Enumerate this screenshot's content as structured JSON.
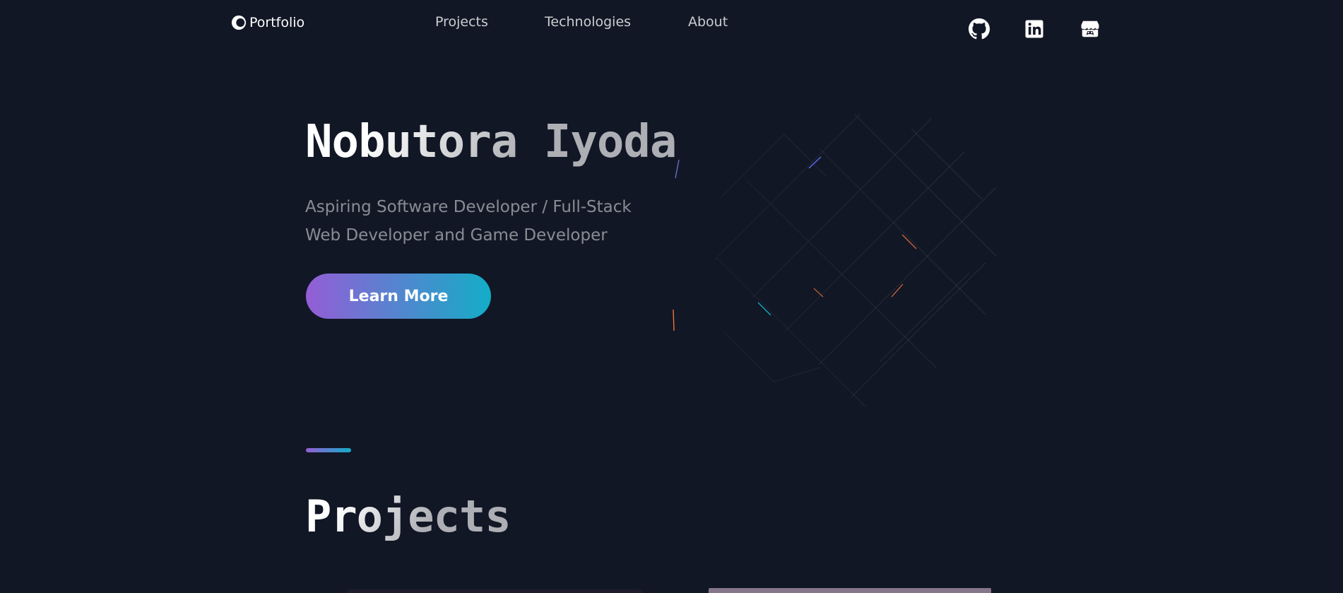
{
  "header": {
    "logo": {
      "text": "Portfolio",
      "icon": "portfolio-logo-icon"
    },
    "nav": [
      {
        "label": "Projects"
      },
      {
        "label": "Technologies"
      },
      {
        "label": "About"
      }
    ],
    "socials": [
      {
        "icon": "github-icon"
      },
      {
        "icon": "linkedin-icon"
      },
      {
        "icon": "itch-io-icon"
      }
    ]
  },
  "hero": {
    "title": "Nobutora Iyoda",
    "subtitle": "Aspiring Software Developer / Full-Stack Web Developer and Game Developer",
    "cta_label": "Learn More"
  },
  "projects": {
    "title": "Projects"
  },
  "colors": {
    "background": "#111725",
    "gradient_start": "#945dd6",
    "gradient_mid": "#6978d1",
    "gradient_end": "#13adc7"
  }
}
